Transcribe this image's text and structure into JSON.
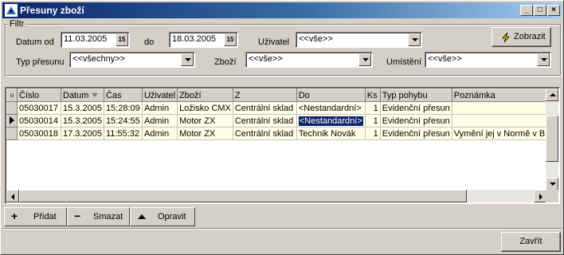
{
  "window": {
    "title": "Přesuny zboží",
    "controls": {
      "minimize": "_",
      "maximize": "□",
      "close": "×"
    }
  },
  "filter": {
    "group_label": "Filtr",
    "date_from_label": "Datum od",
    "date_from_value": "11.03.2005",
    "date_to_label": "do",
    "date_to_value": "18.03.2005",
    "calendar_glyph": "15",
    "user_label": "Uživatel",
    "user_value": "<<vše>>",
    "show_button": "Zobrazit",
    "move_type_label": "Typ přesunu",
    "move_type_value": "<<všechny>>",
    "goods_label": "Zboží",
    "goods_value": "<<vše>>",
    "location_label": "Umístění",
    "location_value": "<<vše>>"
  },
  "grid": {
    "indicator_header": "o",
    "columns": [
      "Číslo",
      "Datum",
      "Čas",
      "Uživatel",
      "Zboží",
      "Z",
      "Do",
      "Ks",
      "Typ pohybu",
      "Poznámka"
    ],
    "sort_column_index": 1,
    "rows": [
      [
        "05030017",
        "15.3.2005",
        "15:28:09",
        "Admin",
        "Ložisko CMX",
        "Centrální sklad",
        "<Nestandardní>",
        "1",
        "Evidenční přesun",
        ""
      ],
      [
        "05030014",
        "15.3.2005",
        "15:24:55",
        "Admin",
        "Motor ZX",
        "Centrální sklad",
        "<Nestandardní>",
        "1",
        "Evidenční přesun",
        ""
      ],
      [
        "05030018",
        "17.3.2005",
        "11:55:32",
        "Admin",
        "Motor ZX",
        "Centrální sklad",
        "Technik Novák",
        "1",
        "Evidenční přesun",
        "Vymění jej v Normě v Bro"
      ]
    ],
    "current_row": 1,
    "selected_cell": {
      "row": 1,
      "col": 6
    },
    "row_color": "#ffffe8",
    "selection_color": "#0a246a"
  },
  "toolbar": {
    "add_label": "Přidat",
    "delete_label": "Smazat",
    "edit_label": "Opravit"
  },
  "footer": {
    "close_label": "Zavřít"
  }
}
